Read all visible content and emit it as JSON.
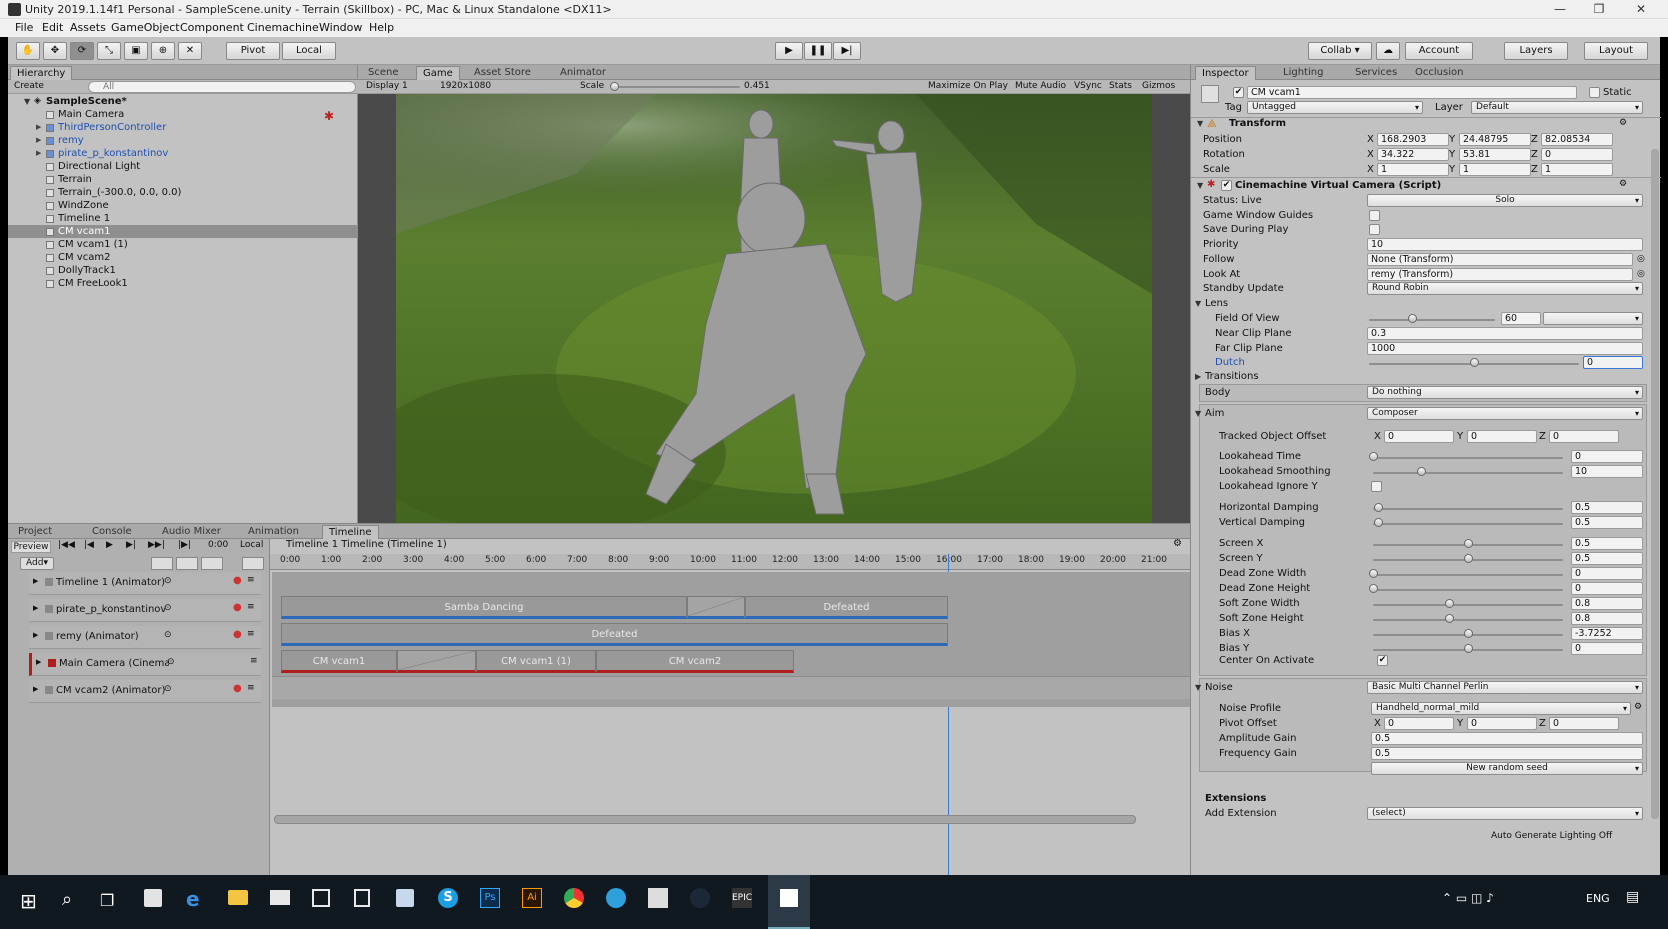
{
  "window": {
    "title": "Unity 2019.1.14f1 Personal - SampleScene.unity - Terrain (Skillbox) - PC, Mac & Linux Standalone <DX11>",
    "minimize": "—",
    "maximize": "❐",
    "close": "✕"
  },
  "menu": [
    "File",
    "Edit",
    "Assets",
    "GameObject",
    "Component",
    "Cinemachine",
    "Window",
    "Help"
  ],
  "toolbar": {
    "pivot": "Pivot",
    "local": "Local",
    "collab": "Collab ▾",
    "account": "Account",
    "layers": "Layers",
    "layout": "Layout"
  },
  "hierarchy": {
    "tab": "Hierarchy",
    "create": "Create",
    "search_placeholder": "All",
    "scene": "SampleScene*",
    "items": [
      {
        "label": "Main Camera",
        "color": "#111"
      },
      {
        "label": "ThirdPersonController",
        "color": "#1e4fb0"
      },
      {
        "label": "remy",
        "color": "#1e4fb0"
      },
      {
        "label": "pirate_p_konstantinov",
        "color": "#1e4fb0"
      },
      {
        "label": "Directional Light",
        "color": "#111"
      },
      {
        "label": "Terrain",
        "color": "#111"
      },
      {
        "label": "Terrain_(-300.0, 0.0, 0.0)",
        "color": "#111"
      },
      {
        "label": "WindZone",
        "color": "#111"
      },
      {
        "label": "Timeline 1",
        "color": "#111"
      },
      {
        "label": "CM vcam1",
        "color": "#111"
      },
      {
        "label": "CM vcam1 (1)",
        "color": "#111"
      },
      {
        "label": "CM vcam2",
        "color": "#111"
      },
      {
        "label": "DollyTrack1",
        "color": "#111"
      },
      {
        "label": "CM FreeLook1",
        "color": "#111"
      }
    ]
  },
  "center_tabs": [
    "Scene",
    "Game",
    "Asset Store",
    "Animator"
  ],
  "game_bar": {
    "display": "Display 1",
    "resolution": "1920x1080",
    "scale_label": "Scale",
    "scale_value": "0.451",
    "maximize": "Maximize On Play",
    "mute": "Mute Audio",
    "vsync": "VSync",
    "stats": "Stats",
    "gizmos": "Gizmos"
  },
  "bottom_tabs": [
    "Project",
    "Console",
    "Audio Mixer",
    "Animation",
    "Timeline"
  ],
  "timeline": {
    "preview": "Preview",
    "time": "0:00",
    "local": "Local",
    "add": "Add▾",
    "title": "Timeline 1 Timeline (Timeline 1)",
    "ruler": [
      "0:00",
      "1:00",
      "2:00",
      "3:00",
      "4:00",
      "5:00",
      "6:00",
      "7:00",
      "8:00",
      "9:00",
      "10:00",
      "11:00",
      "12:00",
      "13:00",
      "14:00",
      "15:00",
      "16:00",
      "17:00",
      "18:00",
      "19:00",
      "20:00",
      "21:00"
    ],
    "tracks": [
      {
        "label": "Timeline 1 (Animator)"
      },
      {
        "label": "pirate_p_konstantinov"
      },
      {
        "label": "remy (Animator)"
      },
      {
        "label": "Main Camera (Cinema"
      },
      {
        "label": "CM vcam2 (Animator)"
      }
    ],
    "clips": {
      "samba": "Samba Dancing",
      "defeated1": "Defeated",
      "defeated2": "Defeated",
      "cm1": "CM vcam1",
      "cm11": "CM vcam1 (1)",
      "cm2": "CM vcam2"
    }
  },
  "inspector": {
    "tabs": [
      "Inspector",
      "Lighting",
      "Services",
      "Occlusion"
    ],
    "object_name": "CM vcam1",
    "static": "Static",
    "tag_label": "Tag",
    "tag": "Untagged",
    "layer_label": "Layer",
    "layer": "Default",
    "transform": {
      "title": "Transform",
      "position": {
        "label": "Position",
        "x": "168.2903",
        "y": "24.48795",
        "z": "82.08534"
      },
      "rotation": {
        "label": "Rotation",
        "x": "34.322",
        "y": "53.81",
        "z": "0"
      },
      "scale": {
        "label": "Scale",
        "x": "1",
        "y": "1",
        "z": "1"
      }
    },
    "vcam": {
      "title": "Cinemachine Virtual Camera (Script)",
      "status": "Status: Live",
      "solo": "Solo",
      "game_window_guides": "Game Window Guides",
      "save_during_play": "Save During Play",
      "priority_label": "Priority",
      "priority": "10",
      "follow_label": "Follow",
      "follow": "None (Transform)",
      "lookat_label": "Look At",
      "lookat": "remy (Transform)",
      "standby_label": "Standby Update",
      "standby": "Round Robin",
      "lens": "Lens",
      "fov_label": "Field Of View",
      "fov": "60",
      "fov_frac": 0.34,
      "near_label": "Near Clip Plane",
      "near": "0.3",
      "far_label": "Far Clip Plane",
      "far": "1000",
      "dutch_label": "Dutch",
      "dutch": "0",
      "dutch_frac": 0.5,
      "transitions": "Transitions",
      "body_label": "Body",
      "body": "Do nothing",
      "aim_label": "Aim",
      "aim": "Composer",
      "tracked_offset": {
        "label": "Tracked Object Offset",
        "x": "0",
        "y": "0",
        "z": "0"
      },
      "aim_params": [
        {
          "label": "Lookahead Time",
          "value": "0",
          "frac": 0.0
        },
        {
          "label": "Lookahead Smoothing",
          "value": "10",
          "frac": 0.25
        },
        {
          "label": "Lookahead Ignore Y",
          "check": true
        },
        {
          "label": "Horizontal Damping",
          "value": "0.5",
          "frac": 0.025
        },
        {
          "label": "Vertical Damping",
          "value": "0.5",
          "frac": 0.025
        },
        {
          "label": "Screen X",
          "value": "0.5",
          "frac": 0.5
        },
        {
          "label": "Screen Y",
          "value": "0.5",
          "frac": 0.5
        },
        {
          "label": "Dead Zone Width",
          "value": "0",
          "frac": 0.0
        },
        {
          "label": "Dead Zone Height",
          "value": "0",
          "frac": 0.0
        },
        {
          "label": "Soft Zone Width",
          "value": "0.8",
          "frac": 0.4
        },
        {
          "label": "Soft Zone Height",
          "value": "0.8",
          "frac": 0.4
        },
        {
          "label": "Bias X",
          "value": "-3.7252",
          "frac": 0.5
        },
        {
          "label": "Bias Y",
          "value": "0",
          "frac": 0.5
        }
      ],
      "center_on_activate": "Center On Activate",
      "noise_label": "Noise",
      "noise": "Basic Multi Channel Perlin",
      "noise_profile_label": "Noise Profile",
      "noise_profile": "Handheld_normal_mild",
      "pivot_offset": {
        "label": "Pivot Offset",
        "x": "0",
        "y": "0",
        "z": "0"
      },
      "amplitude_label": "Amplitude Gain",
      "amplitude": "0.5",
      "frequency_label": "Frequency Gain",
      "frequency": "0.5",
      "new_seed": "New random seed",
      "extensions": "Extensions",
      "add_extension_label": "Add Extension",
      "add_extension": "(select)"
    }
  },
  "status": "Auto Generate Lighting Off",
  "taskbar": {
    "lang": "ENG"
  }
}
